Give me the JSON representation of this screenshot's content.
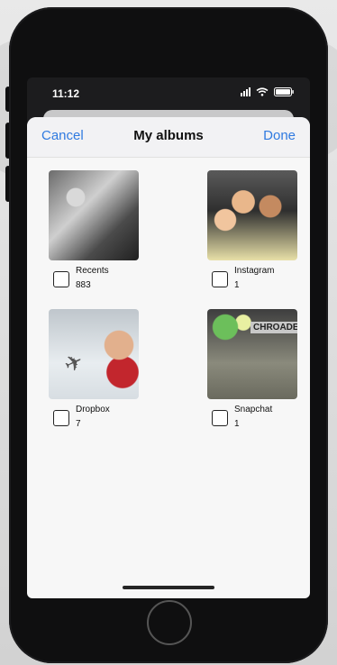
{
  "status_bar": {
    "time": "11:12"
  },
  "sheet": {
    "title": "My albums",
    "cancel_label": "Cancel",
    "done_label": "Done"
  },
  "albums": [
    {
      "name": "Recents",
      "count": "883"
    },
    {
      "name": "Instagram",
      "count": "1"
    },
    {
      "name": "Dropbox",
      "count": "7"
    },
    {
      "name": "Snapchat",
      "count": "1"
    }
  ],
  "thumb_text": {
    "snapchat_sign": "CHROADER"
  },
  "colors": {
    "accent": "#2f7ae0",
    "sheet_bg": "#f7f7f7",
    "phone_frame": "#0f0f10"
  },
  "icons": {
    "signal": "signal-icon",
    "wifi": "wifi-icon",
    "battery": "battery-icon",
    "home": "home-button-icon"
  }
}
